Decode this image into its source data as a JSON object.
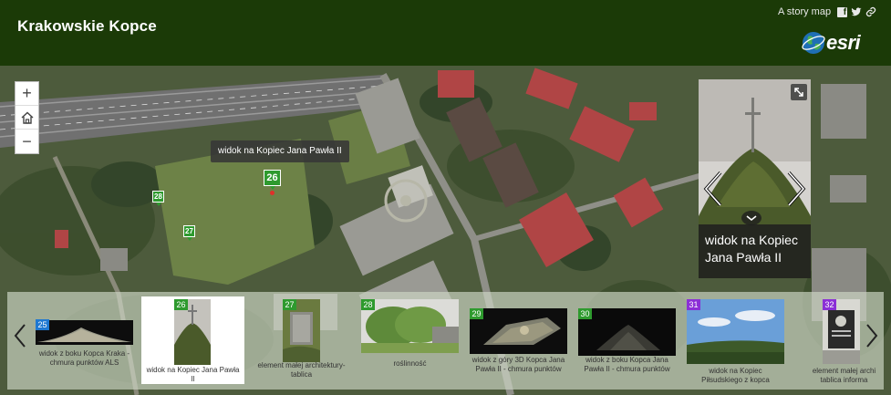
{
  "header": {
    "title": "Krakowskie Kopce",
    "story_link": "A story map",
    "social": [
      "facebook-icon",
      "twitter-icon",
      "link-icon"
    ],
    "logo_text": "esri"
  },
  "colors": {
    "header_bg": "#1b3a07",
    "marker_green": "#2e9a2e",
    "badge_blue": "#1f78d1",
    "badge_purple": "#8b2fd6"
  },
  "map": {
    "zoom_in": "+",
    "zoom_home": "home-icon",
    "zoom_out": "−",
    "tooltip": "widok na Kopiec Jana Pawła II",
    "markers": [
      {
        "num": "26",
        "size": "big"
      },
      {
        "num": "28",
        "size": "small"
      },
      {
        "num": "27",
        "size": "small"
      }
    ]
  },
  "preview": {
    "caption_line1": "widok na Kopiec",
    "caption_line2": "Jana Pawła II"
  },
  "carousel": {
    "items": [
      {
        "num": "25",
        "color": "blue",
        "label": "widok z boku Kopca Kraka -\nchmura punktów ALS"
      },
      {
        "num": "26",
        "color": "green",
        "label": "widok na Kopiec Jana Pawła\nII",
        "active": true
      },
      {
        "num": "27",
        "color": "green",
        "label": "element małej architektury-\ntablica"
      },
      {
        "num": "28",
        "color": "green",
        "label": "roślinność"
      },
      {
        "num": "29",
        "color": "green",
        "label": "widok z góry 3D Kopca Jana\nPawła II - chmura punktów"
      },
      {
        "num": "30",
        "color": "green",
        "label": "widok z boku Kopca Jana\nPawła II - chmura punktów"
      },
      {
        "num": "31",
        "color": "purple",
        "label": "widok na Kopiec\nPiłsudskiego z kopca"
      },
      {
        "num": "32",
        "color": "purple",
        "label": "element małej archi\ntablica informa"
      }
    ]
  }
}
